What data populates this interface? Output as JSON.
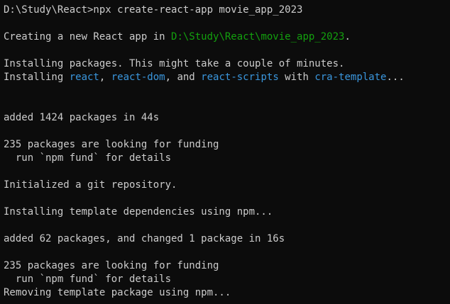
{
  "colors": {
    "background": "#0c0c0c",
    "default": "#cccccc",
    "green": "#13a10e",
    "cyan": "#3a96dd"
  },
  "lines": [
    {
      "segments": [
        {
          "text": "D:\\Study\\React>npx create-react-app movie_app_2023",
          "color": "default"
        }
      ]
    },
    {
      "segments": []
    },
    {
      "segments": [
        {
          "text": "Creating a new React app in ",
          "color": "default"
        },
        {
          "text": "D:\\Study\\React\\movie_app_2023",
          "color": "green"
        },
        {
          "text": ".",
          "color": "default"
        }
      ]
    },
    {
      "segments": []
    },
    {
      "segments": [
        {
          "text": "Installing packages. This might take a couple of minutes.",
          "color": "default"
        }
      ]
    },
    {
      "segments": [
        {
          "text": "Installing ",
          "color": "default"
        },
        {
          "text": "react",
          "color": "cyan"
        },
        {
          "text": ", ",
          "color": "default"
        },
        {
          "text": "react-dom",
          "color": "cyan"
        },
        {
          "text": ", and ",
          "color": "default"
        },
        {
          "text": "react-scripts",
          "color": "cyan"
        },
        {
          "text": " with ",
          "color": "default"
        },
        {
          "text": "cra-template",
          "color": "cyan"
        },
        {
          "text": "...",
          "color": "default"
        }
      ]
    },
    {
      "segments": []
    },
    {
      "segments": []
    },
    {
      "segments": [
        {
          "text": "added 1424 packages in 44s",
          "color": "default"
        }
      ]
    },
    {
      "segments": []
    },
    {
      "segments": [
        {
          "text": "235 packages are looking for funding",
          "color": "default"
        }
      ]
    },
    {
      "segments": [
        {
          "text": "  run `npm fund` for details",
          "color": "default"
        }
      ]
    },
    {
      "segments": []
    },
    {
      "segments": [
        {
          "text": "Initialized a git repository.",
          "color": "default"
        }
      ]
    },
    {
      "segments": []
    },
    {
      "segments": [
        {
          "text": "Installing template dependencies using npm...",
          "color": "default"
        }
      ]
    },
    {
      "segments": []
    },
    {
      "segments": [
        {
          "text": "added 62 packages, and changed 1 package in 16s",
          "color": "default"
        }
      ]
    },
    {
      "segments": []
    },
    {
      "segments": [
        {
          "text": "235 packages are looking for funding",
          "color": "default"
        }
      ]
    },
    {
      "segments": [
        {
          "text": "  run `npm fund` for details",
          "color": "default"
        }
      ]
    },
    {
      "segments": [
        {
          "text": "Removing template package using npm...",
          "color": "default"
        }
      ]
    }
  ]
}
